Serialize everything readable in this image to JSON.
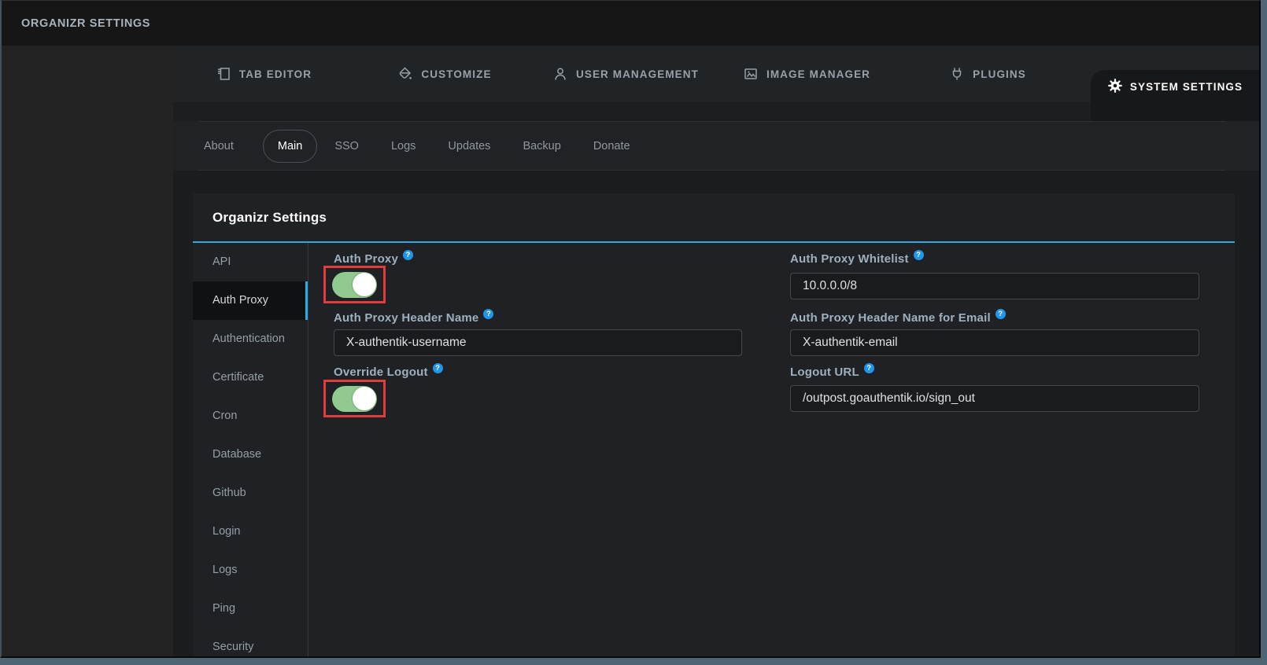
{
  "app": {
    "title": "ORGANIZR SETTINGS"
  },
  "nav": {
    "tabs": [
      {
        "label": "TAB EDITOR"
      },
      {
        "label": "CUSTOMIZE"
      },
      {
        "label": "USER MANAGEMENT"
      },
      {
        "label": "IMAGE MANAGER"
      },
      {
        "label": "PLUGINS"
      },
      {
        "label": "SYSTEM SETTINGS"
      }
    ],
    "active_tab": "SYSTEM SETTINGS"
  },
  "subnav": {
    "tabs": [
      {
        "label": "About"
      },
      {
        "label": "Main"
      },
      {
        "label": "SSO"
      },
      {
        "label": "Logs"
      },
      {
        "label": "Updates"
      },
      {
        "label": "Backup"
      },
      {
        "label": "Donate"
      }
    ],
    "active_tab": "Main"
  },
  "panel": {
    "title": "Organizr Settings"
  },
  "settings_menu": {
    "items": [
      {
        "label": "API"
      },
      {
        "label": "Auth Proxy"
      },
      {
        "label": "Authentication"
      },
      {
        "label": "Certificate"
      },
      {
        "label": "Cron"
      },
      {
        "label": "Database"
      },
      {
        "label": "Github"
      },
      {
        "label": "Login"
      },
      {
        "label": "Logs"
      },
      {
        "label": "Ping"
      },
      {
        "label": "Security"
      }
    ],
    "active_item": "Auth Proxy"
  },
  "form": {
    "auth_proxy": {
      "label": "Auth Proxy",
      "state": "on"
    },
    "auth_proxy_whitelist": {
      "label": "Auth Proxy Whitelist",
      "value": "10.0.0.0/8"
    },
    "auth_proxy_header_name": {
      "label": "Auth Proxy Header Name",
      "value": "X-authentik-username"
    },
    "auth_proxy_header_name_email": {
      "label": "Auth Proxy Header Name for Email",
      "value": "X-authentik-email"
    },
    "override_logout": {
      "label": "Override Logout",
      "state": "on"
    },
    "logout_url": {
      "label": "Logout URL",
      "value": "/outpost.goauthentik.io/sign_out"
    }
  },
  "icons": {
    "help": "?"
  },
  "colors": {
    "accent": "#2cabe3",
    "toggle_on": "#90ca90",
    "highlight_box": "#e13c3c",
    "frame": "#4e6673"
  }
}
